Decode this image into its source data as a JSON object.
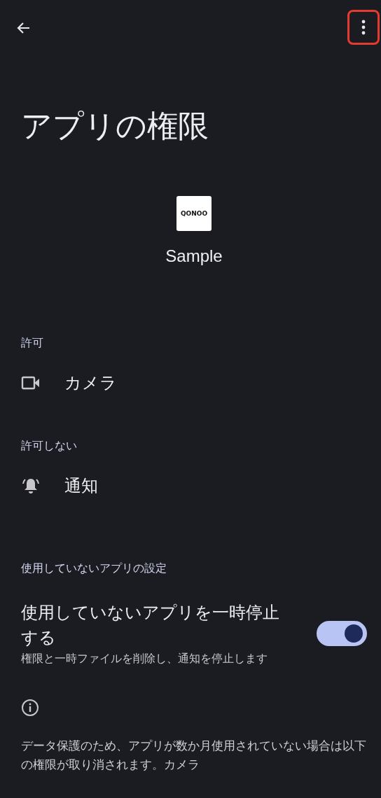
{
  "toolbar": {
    "menu_highlighted": true
  },
  "title": "アプリの権限",
  "app": {
    "icon_text": "QONOO",
    "name": "Sample"
  },
  "sections": [
    {
      "header": "許可",
      "items": [
        {
          "kind": "camera",
          "label": "カメラ"
        }
      ]
    },
    {
      "header": "許可しない",
      "items": [
        {
          "kind": "bell",
          "label": "通知"
        }
      ]
    }
  ],
  "unused": {
    "header": "使用していないアプリの設定",
    "title": "使用していないアプリを一時停止する",
    "subtitle": "権限と一時ファイルを削除し、通知を停止します",
    "on": true
  },
  "info": "データ保護のため、アプリが数か月使用されていない場合は以下の権限が取り消されます。カメラ"
}
